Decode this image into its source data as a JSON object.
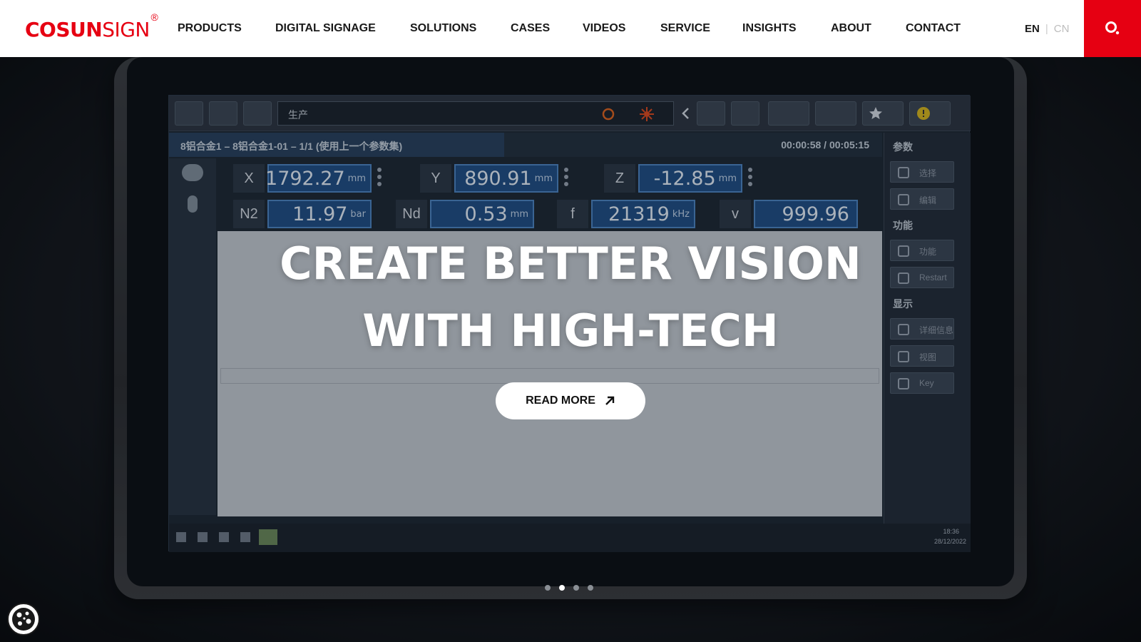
{
  "header": {
    "logo_bold": "COSUN",
    "logo_light": "SIGN",
    "logo_reg": "®",
    "nav": [
      {
        "label": "PRODUCTS"
      },
      {
        "label": "DIGITAL SIGNAGE"
      },
      {
        "label": "SOLUTIONS"
      },
      {
        "label": "CASES"
      },
      {
        "label": "VIDEOS"
      },
      {
        "label": "SERVICE"
      },
      {
        "label": "INSIGHTS"
      },
      {
        "label": "ABOUT"
      },
      {
        "label": "CONTACT"
      }
    ],
    "lang_en": "EN",
    "lang_sep": "|",
    "lang_cn": "CN",
    "search_icon": "search-icon",
    "accent_color": "#e60012"
  },
  "hero": {
    "title_line1": "CREATE BETTER VISION",
    "title_line2": "WITH HIGH-TECH",
    "cta_label": "READ MORE",
    "cta_icon": "arrow-up-right-icon",
    "slides_total": 4,
    "active_slide": 2
  },
  "screen_ui": {
    "toolbar_field": "生产",
    "job_text": "8铝合金1 – 8铝合金1-01 – 1/1 (使用上一个参数集)",
    "time_text": "00:00:58 / 00:05:15",
    "side_head_params": "参数",
    "side_head_func": "功能",
    "side_head_display": "显示",
    "side_buttons": [
      {
        "label": "选择"
      },
      {
        "label": "编辑"
      },
      {
        "label": "功能"
      },
      {
        "label": "Restart"
      },
      {
        "label": "详细信息"
      },
      {
        "label": "视图"
      },
      {
        "label": "Key"
      }
    ],
    "readouts": [
      {
        "label": "X",
        "value": "1792.27",
        "unit": "mm"
      },
      {
        "label": "Y",
        "value": "890.91",
        "unit": "mm"
      },
      {
        "label": "Z",
        "value": "-12.85",
        "unit": "mm"
      },
      {
        "label": "N2",
        "value": "11.97",
        "unit": "bar"
      },
      {
        "label": "Nd",
        "value": "0.53",
        "unit": "mm"
      },
      {
        "label": "f",
        "value": "21319",
        "unit": "kHz"
      },
      {
        "label": "v",
        "value": "999.96",
        "unit": ""
      }
    ],
    "clock_time": "18:36",
    "clock_date": "28/12/2022"
  },
  "cookie": {
    "icon": "cookie-icon"
  }
}
